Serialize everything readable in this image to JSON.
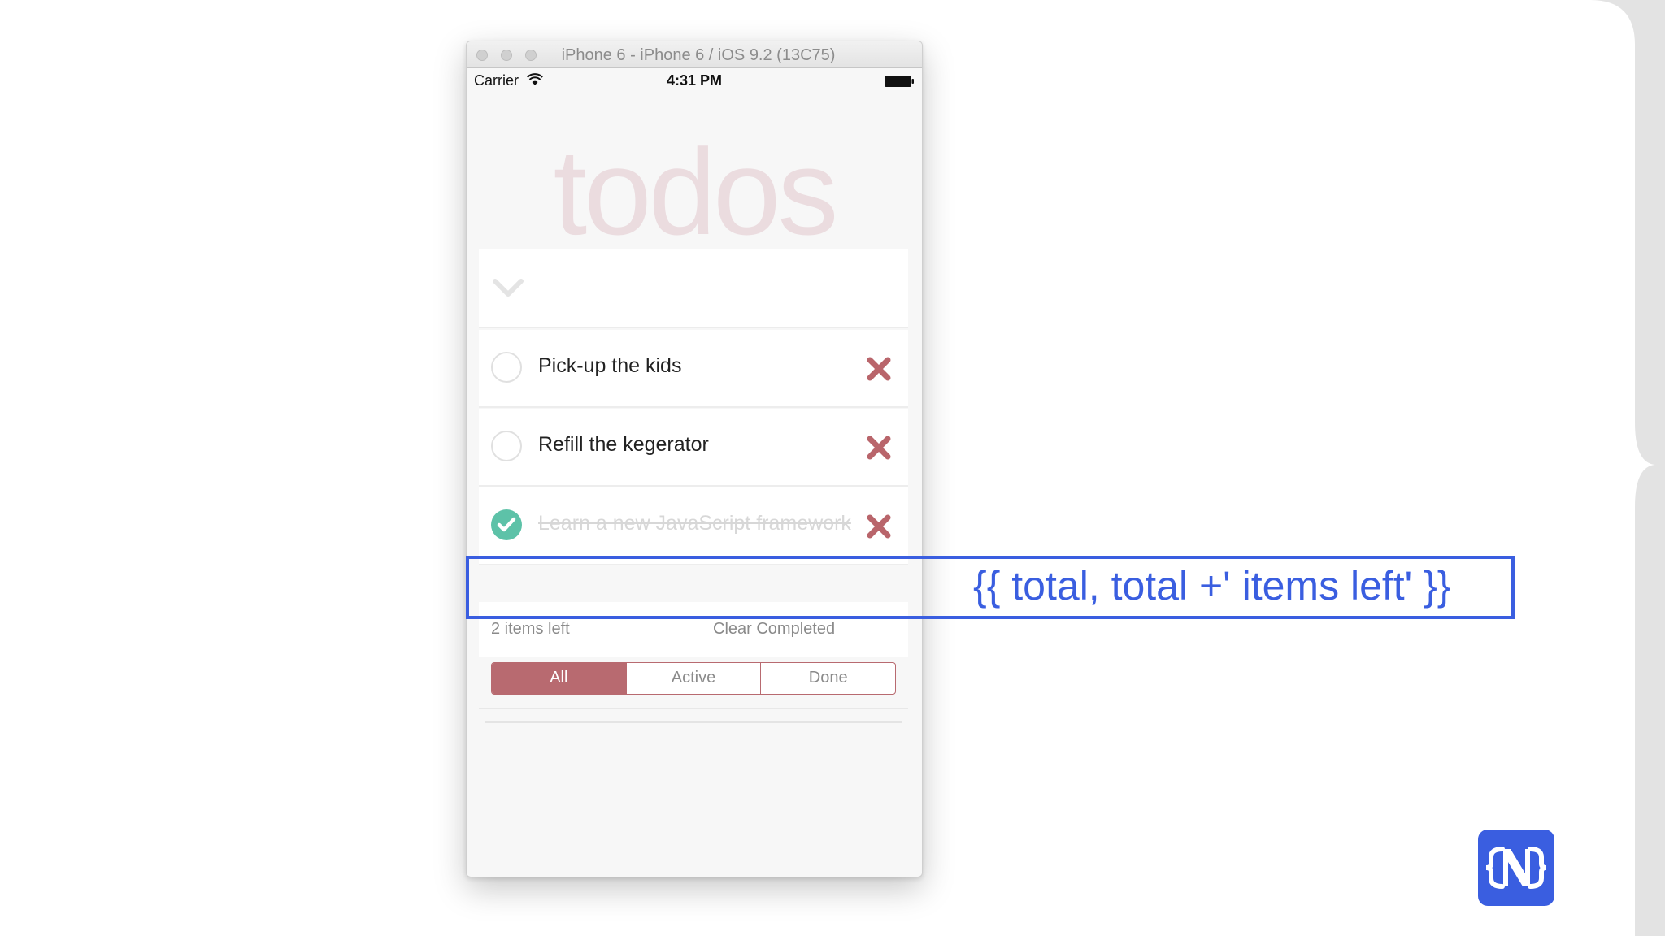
{
  "simulator": {
    "window_title": "iPhone 6 - iPhone 6 / iOS 9.2 (13C75)"
  },
  "status_bar": {
    "carrier": "Carrier",
    "time": "4:31 PM",
    "icons": [
      "wifi-icon",
      "battery-icon"
    ]
  },
  "app": {
    "title": "todos",
    "toggle_all_icon": "chevron-down-icon",
    "todos": [
      {
        "label": "Pick-up the kids",
        "completed": false
      },
      {
        "label": "Refill the kegerator",
        "completed": false
      },
      {
        "label": "Learn a new JavaScript framework",
        "completed": true
      }
    ],
    "footer": {
      "items_left": "2 items left",
      "clear_completed": "Clear Completed"
    },
    "filters": {
      "tabs": [
        "All",
        "Active",
        "Done"
      ],
      "selected": "All"
    }
  },
  "annotation": {
    "text": "{{ total, total +' items left' }}"
  },
  "colors": {
    "accent_blue": "#3a5ee0",
    "filter_red": "#b86a70",
    "check_green": "#5dc2a8",
    "delete_red": "#b9656b",
    "title_pink": "#ebdcdf"
  },
  "logo": {
    "icon": "nativescript-logo-icon"
  }
}
